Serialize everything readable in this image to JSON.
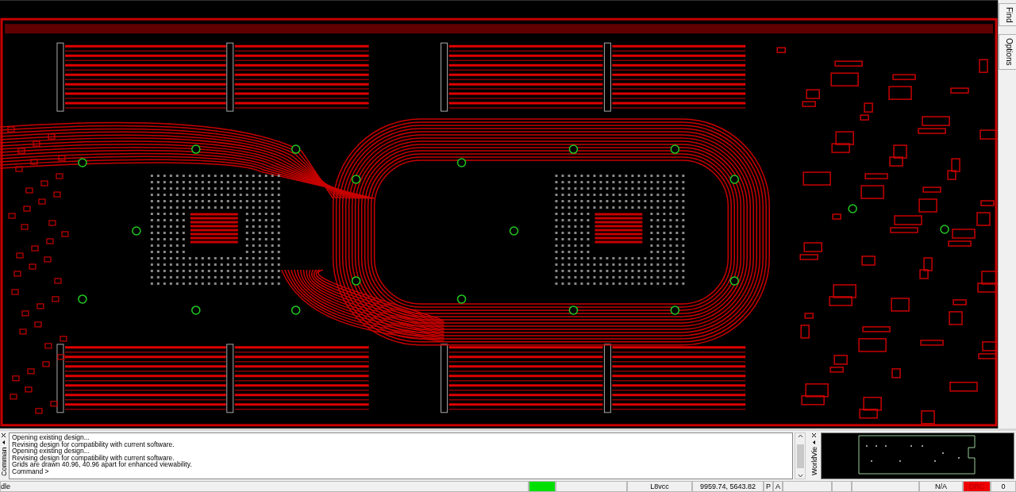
{
  "side_tabs": [
    {
      "label": "Find"
    },
    {
      "label": "Options"
    }
  ],
  "command_panel": {
    "title": "Comman",
    "lines": [
      "Opening existing design...",
      "Revising design for compatibility with current software.",
      "Opening existing design...",
      "Revising design for compatibility with current software.",
      "Grids are drawn 40.96, 40.96 apart for enhanced viewability.",
      "Command >"
    ]
  },
  "worldview": {
    "title": "WorldVie"
  },
  "status_bar": {
    "state": "dle",
    "layer": "L8vcc",
    "coordinates": "9959.74, 5643.82",
    "p": "P",
    "a": "A",
    "na": "N/A",
    "drc": "DRC",
    "drc_count": "0"
  }
}
